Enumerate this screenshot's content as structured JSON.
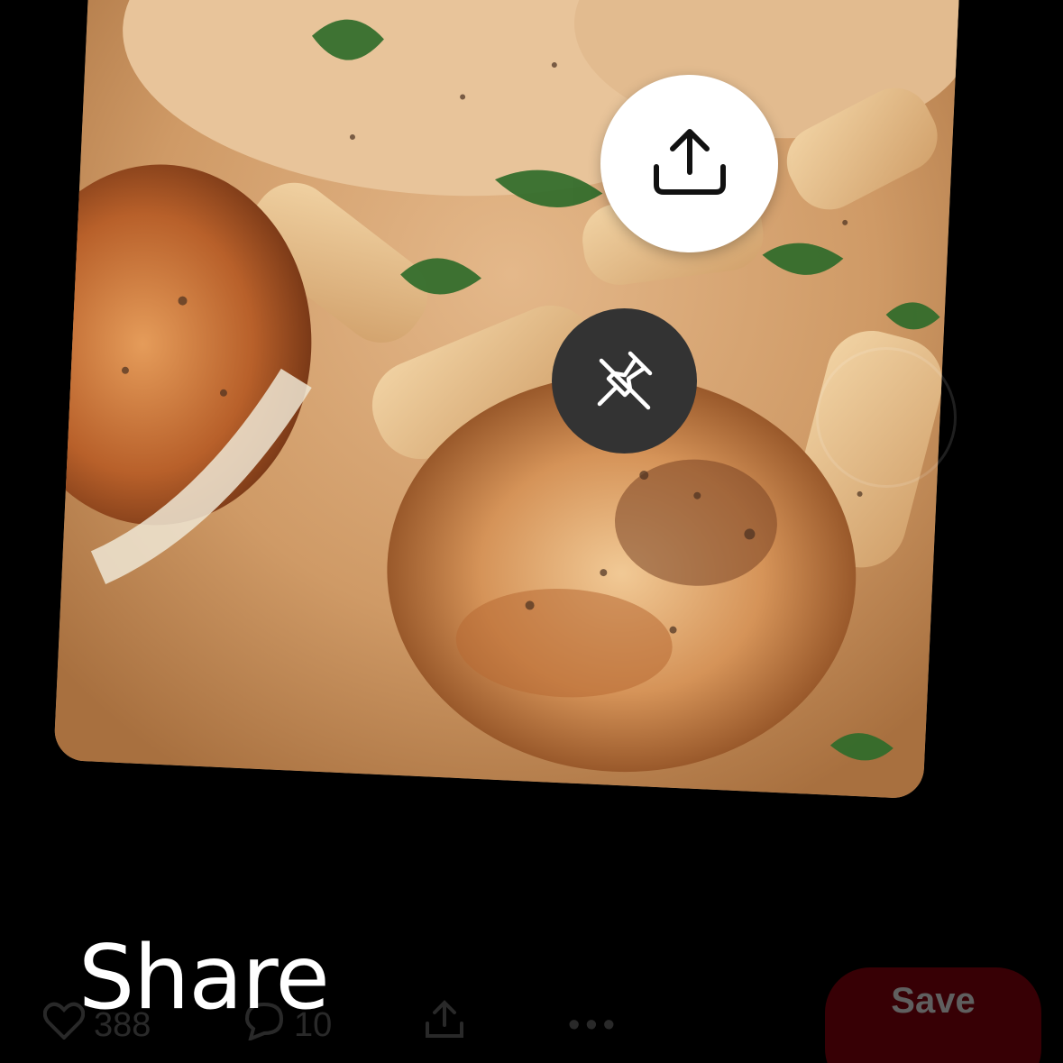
{
  "tooltip": {
    "label": "Share"
  },
  "pin_actions": {
    "share_icon": "share-upload-icon",
    "unpin_icon": "pushpin-slash-icon"
  },
  "action_bar": {
    "like_icon": "heart-icon",
    "like_count": "388",
    "comment_icon": "comment-bubble-icon",
    "comment_count": "10",
    "share_icon": "share-upload-icon",
    "more_label": "•••",
    "save_label": "Save"
  },
  "colors": {
    "background": "#000000",
    "share_circle": "#ffffff",
    "pin_circle": "#333333",
    "save_button": "#e60023"
  }
}
